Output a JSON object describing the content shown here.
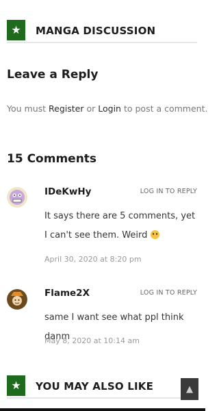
{
  "header": {
    "icon": "star-icon",
    "title": "MANGA DISCUSSION"
  },
  "reply_section": {
    "title": "Leave a Reply",
    "prefix": "You must",
    "register_label": "Register",
    "or_text": "or",
    "login_label": "Login",
    "suffix": "to post a comment."
  },
  "comments_heading": "15 Comments",
  "comments": [
    {
      "author": "IDeKwHy",
      "reply_label": "LOG IN TO REPLY",
      "text": "It says there are 5 comments, yet I can't see them. Weird",
      "emoji": "confused-face-icon",
      "date": "April 30, 2020 at 8:20 pm"
    },
    {
      "author": "Flame2X",
      "reply_label": "LOG IN TO REPLY",
      "text": "same I want see what ppl think danm",
      "date": "May 8, 2020 at 10:14 am"
    }
  ],
  "related": {
    "icon": "star-icon",
    "title": "YOU MAY ALSO LIKE"
  },
  "back_to_top": {
    "icon": "arrow-up-icon",
    "glyph": "▲"
  },
  "colors": {
    "accent": "#1e6b1e",
    "text": "#2b2b2b",
    "muted": "#999999"
  }
}
